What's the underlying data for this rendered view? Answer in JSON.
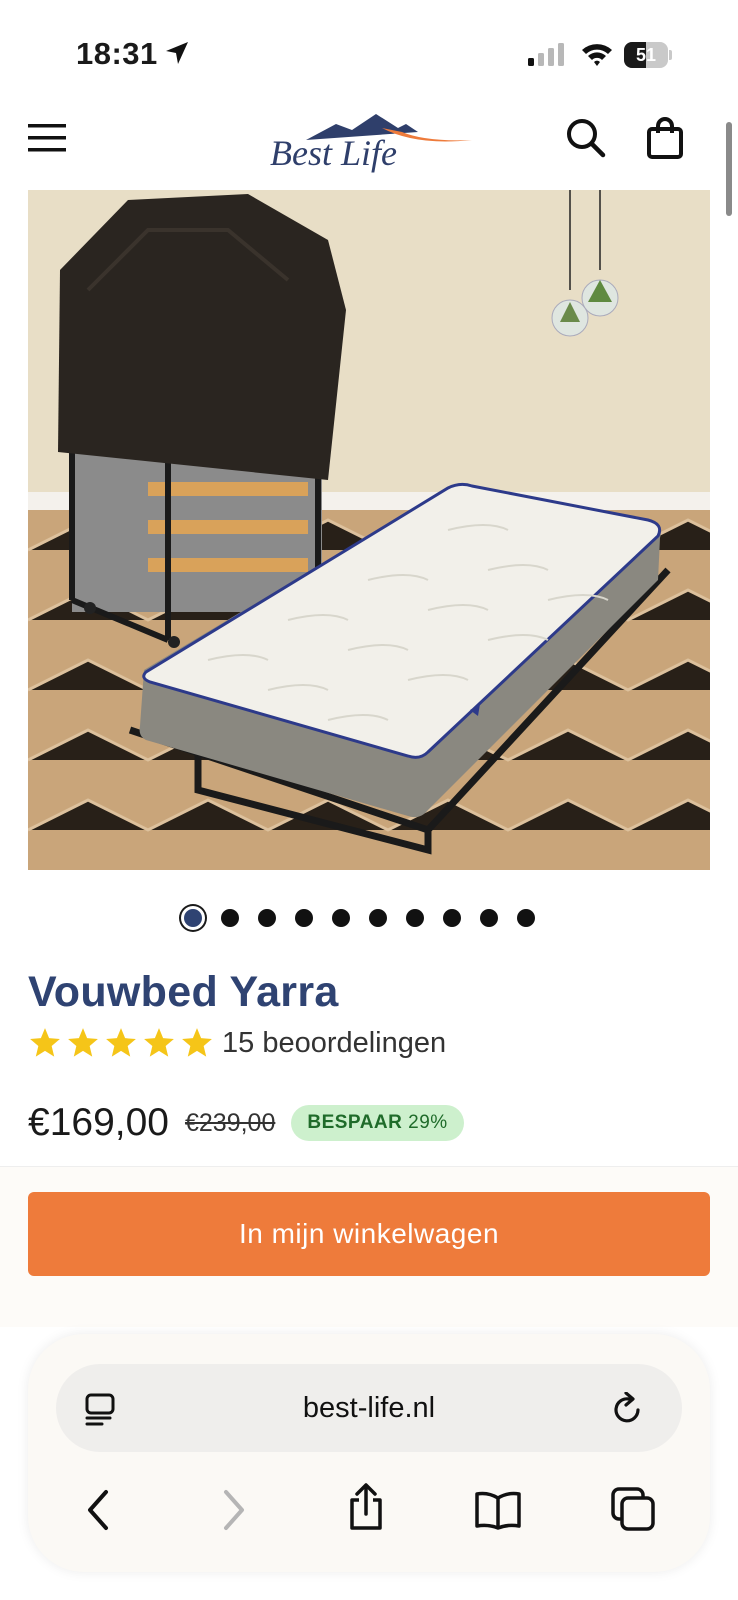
{
  "status_bar": {
    "time": "18:31",
    "battery_level": "51",
    "battery_fraction": 0.51
  },
  "header": {
    "logo_text": "Best Life",
    "icons": [
      "menu-icon",
      "search-icon",
      "cart-icon"
    ]
  },
  "product": {
    "gallery": {
      "slide_count": 10,
      "active_index": 0
    },
    "title": "Vouwbed Yarra",
    "rating": {
      "stars": 5,
      "max": 5
    },
    "review_count": "15 beoordelingen",
    "price": "€169,00",
    "old_price": "€239,00",
    "badge": {
      "label": "BESPAAR",
      "value": "29%"
    }
  },
  "actions": {
    "add_to_cart": "In mijn winkelwagen"
  },
  "browser": {
    "url": "best-life.nl",
    "toolbar_icons": [
      "back-icon",
      "forward-icon",
      "share-icon",
      "bookmarks-icon",
      "tabs-icon"
    ]
  },
  "colors": {
    "brand_navy": "#2f4372",
    "cta_orange": "#ee7b3b",
    "badge_bg": "#cdf0cd",
    "badge_text": "#1f6b2a",
    "star": "#f5c518"
  }
}
